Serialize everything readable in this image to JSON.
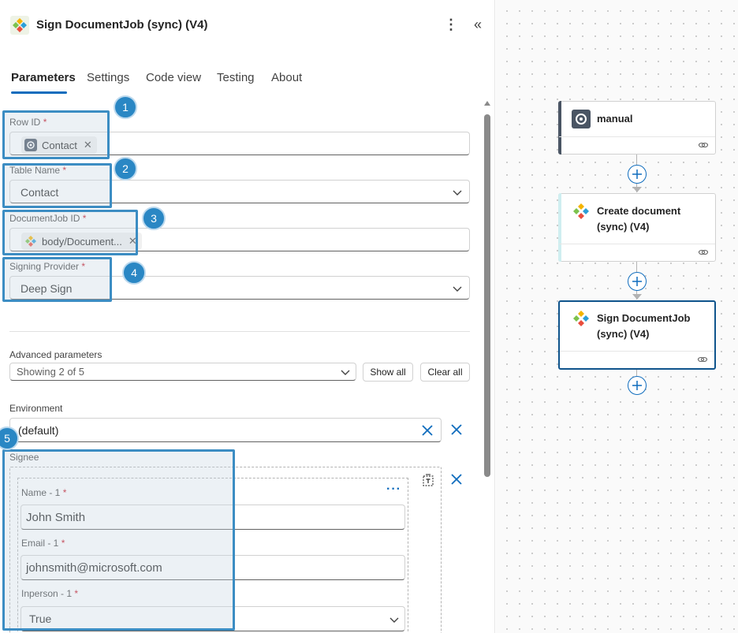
{
  "panel": {
    "title": "Sign DocumentJob (sync) (V4)",
    "tabs": [
      {
        "label": "Parameters",
        "active": true
      },
      {
        "label": "Settings",
        "active": false
      },
      {
        "label": "Code view",
        "active": false
      },
      {
        "label": "Testing",
        "active": false
      },
      {
        "label": "About",
        "active": false
      }
    ]
  },
  "fields": {
    "row_id": {
      "label": "Row ID",
      "required": "*",
      "chip": "Contact"
    },
    "table_name": {
      "label": "Table Name",
      "required": "*",
      "value": "Contact"
    },
    "documentjob_id": {
      "label": "DocumentJob ID",
      "required": "*",
      "chip": "body/Document..."
    },
    "signing_provider": {
      "label": "Signing Provider",
      "required": "*",
      "value": "Deep Sign"
    }
  },
  "advanced": {
    "label": "Advanced parameters",
    "value": "Showing 2 of 5",
    "show_all": "Show all",
    "clear_all": "Clear all"
  },
  "environment": {
    "label": "Environment",
    "value": "(default)"
  },
  "signee": {
    "label": "Signee",
    "name": {
      "label": "Name - 1",
      "required": "*",
      "value": "John Smith"
    },
    "email": {
      "label": "Email - 1",
      "required": "*",
      "value": "johnsmith@microsoft.com"
    },
    "inperson": {
      "label": "Inperson - 1",
      "required": "*",
      "value": "True"
    }
  },
  "callouts": [
    "1",
    "2",
    "3",
    "4",
    "5"
  ],
  "flow": {
    "steps": [
      {
        "title": "manual",
        "icon": "dataverse-icon"
      },
      {
        "title": "Create document (sync) (V4)",
        "icon": "plumsail-icon"
      },
      {
        "title": "Sign DocumentJob (sync) (V4)",
        "icon": "plumsail-icon",
        "selected": true
      }
    ]
  },
  "colors": {
    "accent": "#0f6cbd",
    "callout": "#2a87c4",
    "selected_border": "#0f548c"
  }
}
